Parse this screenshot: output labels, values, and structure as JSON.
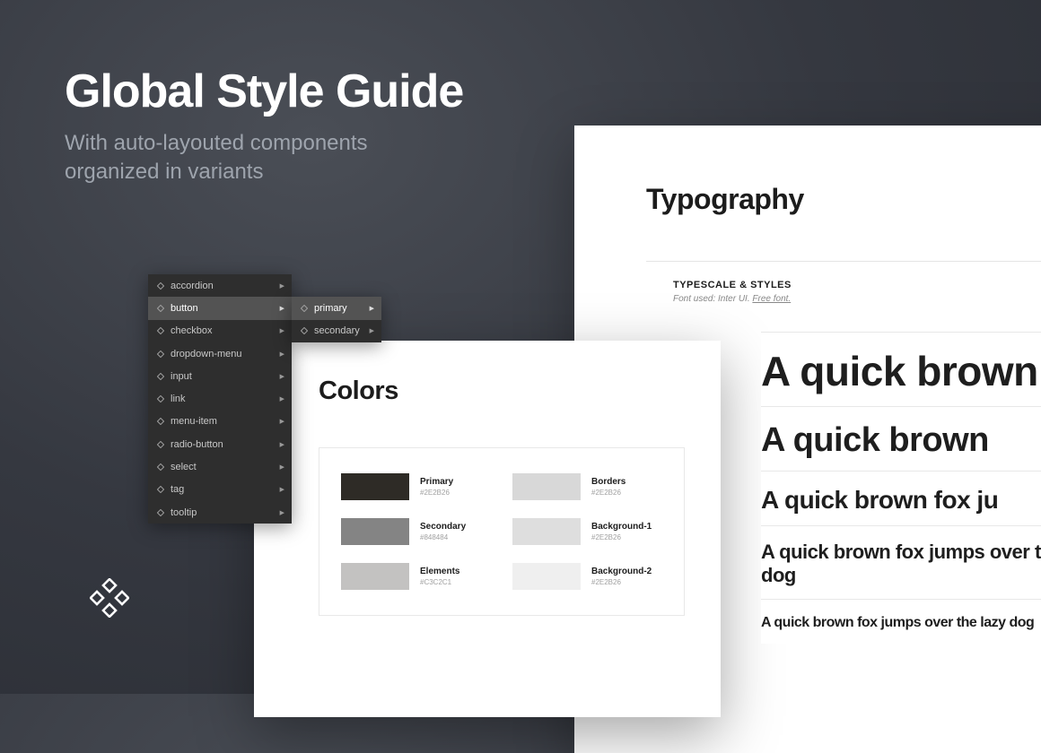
{
  "header": {
    "title": "Global Style Guide",
    "subtitle": "With auto-layouted components\norganized in variants"
  },
  "menu": {
    "items": [
      "accordion",
      "button",
      "checkbox",
      "dropdown-menu",
      "input",
      "link",
      "menu-item",
      "radio-button",
      "select",
      "tag",
      "tooltip"
    ],
    "active_index": 1,
    "submenu": [
      "primary",
      "secondary"
    ]
  },
  "colors": {
    "title": "Colors",
    "swatches": [
      {
        "name": "Primary",
        "hex": "#2E2B26",
        "color": "#2E2B26"
      },
      {
        "name": "Borders",
        "hex": "#2E2B26",
        "color": "#d8d8d8"
      },
      {
        "name": "Secondary",
        "hex": "#848484",
        "color": "#848484"
      },
      {
        "name": "Background-1",
        "hex": "#2E2B26",
        "color": "#dedede"
      },
      {
        "name": "Elements",
        "hex": "#C3C2C1",
        "color": "#c3c2c1"
      },
      {
        "name": "Background-2",
        "hex": "#2E2B26",
        "color": "#efefef"
      }
    ]
  },
  "typography": {
    "title": "Typography",
    "section_title": "TYPESCALE & STYLES",
    "font_note": "Font used: Inter UI.",
    "font_link": "Free font.",
    "samples": [
      "A quick brown",
      "A quick brown",
      "A quick brown fox ju",
      "A quick brown fox jumps over the lazy dog",
      "A quick brown fox jumps over the lazy dog"
    ]
  }
}
